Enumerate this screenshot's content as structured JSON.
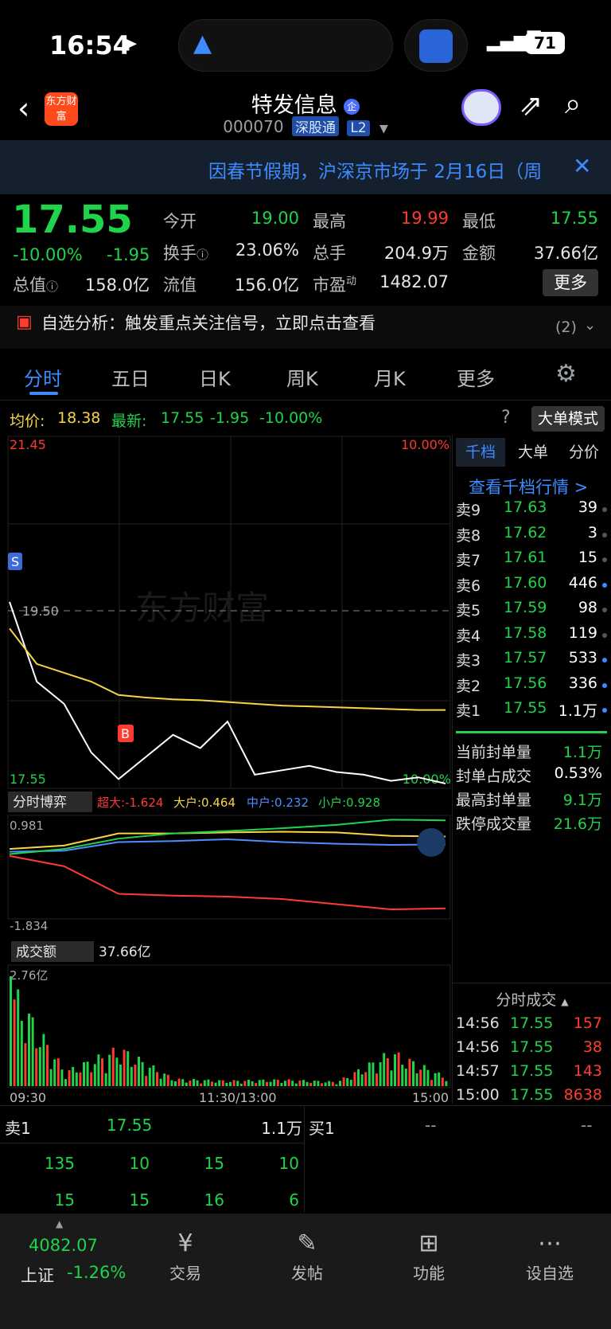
{
  "status_bar": {
    "time": "16:54",
    "battery": "71"
  },
  "header": {
    "logo": "东方财富",
    "title": "特发信息",
    "title_badge": "企",
    "code": "000070",
    "market_tag": "深股通",
    "level_tag": "L2"
  },
  "notice": {
    "text": "因春节假期，沪深京市场于 2月16日（周"
  },
  "quote": {
    "price": "17.55",
    "change_pct": "-10.00%",
    "change": "-1.95",
    "open_label": "今开",
    "open": "19.00",
    "high_label": "最高",
    "high": "19.99",
    "low_label": "最低",
    "low": "17.55",
    "turnover_label": "换手",
    "turnover": "23.06%",
    "volume_label": "总手",
    "volume": "204.9万",
    "amount_label": "金额",
    "amount": "37.66亿",
    "mktcap_label": "总值",
    "mktcap": "158.0亿",
    "float_label": "流值",
    "float": "156.0亿",
    "pe_label": "市盈",
    "pe_sup": "动",
    "pe": "1482.07",
    "more": "更多"
  },
  "analysis": {
    "text": "自选分析：触发重点关注信号，立即点击查看",
    "count": "(2)"
  },
  "tabs": [
    {
      "label": "分时"
    },
    {
      "label": "五日"
    },
    {
      "label": "日K"
    },
    {
      "label": "周K"
    },
    {
      "label": "月K"
    },
    {
      "label": "更多"
    }
  ],
  "chart_info": {
    "avg_label": "均价:",
    "avg": "18.38",
    "last_label": "最新:",
    "last": "17.55",
    "chg": "-1.95",
    "pct": "-10.00%",
    "mode": "大单模式"
  },
  "chart_labels": {
    "top": "21.45",
    "top_pct": "10.00%",
    "bottom": "17.55",
    "bottom_pct": "-10.00%",
    "prev_close": "19.50",
    "s_marker": "S",
    "b_marker": "B",
    "watermark": "东方财富",
    "game_label": "分时博弈",
    "super": "超大:-1.624",
    "big": "大户:0.464",
    "mid": "中户:0.232",
    "small": "小户:0.928",
    "game_top": "0.981",
    "game_bottom": "-1.834",
    "vol_label": "成交额",
    "vol_total": "37.66亿",
    "vol_max": "2.76亿",
    "t_start": "09:30",
    "t_mid": "11:30/13:00",
    "t_end": "15:00"
  },
  "chart_data": [
    {
      "type": "line",
      "title": "",
      "x": [
        "09:30",
        "09:45",
        "10:00",
        "10:15",
        "10:30",
        "10:45",
        "11:00",
        "11:15",
        "11:30",
        "13:15",
        "13:30",
        "13:45",
        "14:00",
        "14:15",
        "14:30",
        "14:45",
        "15:00"
      ],
      "series": [
        {
          "name": "最新",
          "values": [
            19.6,
            18.7,
            18.45,
            17.9,
            17.6,
            17.85,
            18.1,
            17.95,
            18.25,
            17.65,
            17.7,
            17.75,
            17.68,
            17.65,
            17.58,
            17.62,
            17.55
          ]
        },
        {
          "name": "均价",
          "values": [
            19.3,
            18.9,
            18.8,
            18.7,
            18.55,
            18.52,
            18.5,
            18.49,
            18.47,
            18.45,
            18.43,
            18.42,
            18.41,
            18.4,
            18.39,
            18.38,
            18.38
          ]
        }
      ],
      "ylim": [
        17.55,
        21.45
      ],
      "reference": 19.5
    },
    {
      "type": "line",
      "title": "",
      "x": [
        "09:30",
        "10:00",
        "10:30",
        "11:00",
        "11:30",
        "13:30",
        "14:00",
        "14:30",
        "15:00"
      ],
      "series": [
        {
          "name": "超大",
          "values": [
            -0.1,
            -0.4,
            -1.2,
            -1.25,
            -1.28,
            -1.35,
            -1.5,
            -1.65,
            -1.62
          ]
        },
        {
          "name": "大户",
          "values": [
            0.1,
            0.2,
            0.55,
            0.55,
            0.58,
            0.6,
            0.58,
            0.48,
            0.46
          ]
        },
        {
          "name": "中户",
          "values": [
            0.02,
            0.05,
            0.3,
            0.33,
            0.38,
            0.3,
            0.25,
            0.22,
            0.23
          ]
        },
        {
          "name": "小户",
          "values": [
            -0.05,
            0.1,
            0.4,
            0.55,
            0.62,
            0.7,
            0.8,
            0.95,
            0.93
          ]
        }
      ],
      "ylim": [
        -1.834,
        0.981
      ]
    },
    {
      "type": "bar",
      "title": "",
      "categories": [
        "09:30",
        "10:00",
        "10:30",
        "11:00",
        "11:30",
        "13:30",
        "14:00",
        "14:30",
        "15:00"
      ],
      "values": [
        2.76,
        0.4,
        1.05,
        0.2,
        0.15,
        0.18,
        0.12,
        0.95,
        0.25
      ],
      "ylabel": "成交额",
      "ylim": [
        0,
        2.76
      ]
    }
  ],
  "order_book": {
    "tabs": [
      "千档",
      "大单",
      "分价"
    ],
    "link": "查看千档行情 >",
    "sells": [
      {
        "label": "卖9",
        "price": "17.63",
        "vol": "39"
      },
      {
        "label": "卖8",
        "price": "17.62",
        "vol": "3"
      },
      {
        "label": "卖7",
        "price": "17.61",
        "vol": "15"
      },
      {
        "label": "卖6",
        "price": "17.60",
        "vol": "446"
      },
      {
        "label": "卖5",
        "price": "17.59",
        "vol": "98"
      },
      {
        "label": "卖4",
        "price": "17.58",
        "vol": "119"
      },
      {
        "label": "卖3",
        "price": "17.57",
        "vol": "533"
      },
      {
        "label": "卖2",
        "price": "17.56",
        "vol": "336"
      },
      {
        "label": "卖1",
        "price": "17.55",
        "vol": "1.1万"
      }
    ],
    "stats": [
      {
        "label": "当前封单量",
        "value": "1.1万"
      },
      {
        "label": "封单占成交",
        "value": "0.53%"
      },
      {
        "label": "最高封单量",
        "value": "9.1万"
      },
      {
        "label": "跌停成交量",
        "value": "21.6万"
      }
    ],
    "trades_title": "分时成交",
    "trades": [
      {
        "time": "14:56",
        "price": "17.55",
        "vol": "157"
      },
      {
        "time": "14:56",
        "price": "17.55",
        "vol": "38"
      },
      {
        "time": "14:57",
        "price": "17.55",
        "vol": "143"
      },
      {
        "time": "15:00",
        "price": "17.55",
        "vol": "8638"
      }
    ]
  },
  "level1": {
    "sell_label": "卖1",
    "sell_price": "17.55",
    "sell_vol": "1.1万",
    "buy_label": "买1",
    "buy_price": "--",
    "buy_vol": "--",
    "row1": [
      "135",
      "10",
      "15",
      "10"
    ],
    "row2": [
      "15",
      "15",
      "16",
      "6"
    ]
  },
  "bottom_nav": {
    "index_value": "4082.07",
    "index_name": "上证",
    "index_pct": "-1.26%",
    "items": [
      {
        "label": "交易"
      },
      {
        "label": "发帖"
      },
      {
        "label": "功能"
      },
      {
        "label": "设自选"
      }
    ]
  }
}
